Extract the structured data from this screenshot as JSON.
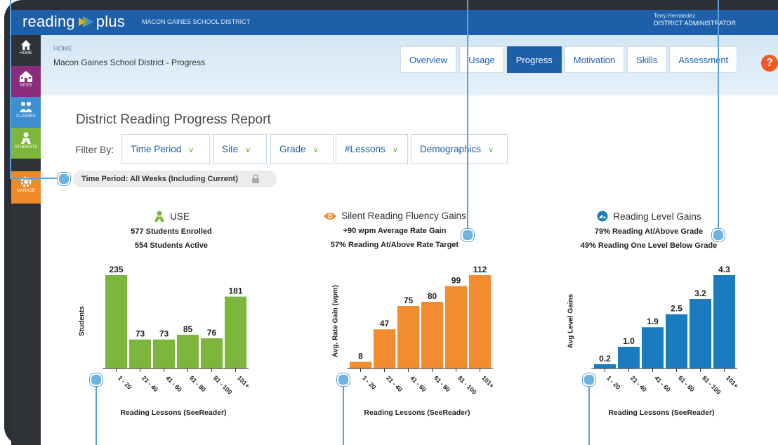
{
  "app": {
    "logo_text": "reading",
    "logo_text2": "plus",
    "district": "MACON GAINES SCHOOL DISTRICT",
    "user_name": "Terry Hernandez",
    "user_role": "DISTRICT ADMINISTRATOR"
  },
  "nav": [
    {
      "label": "HOME",
      "icon": "home-icon",
      "color": "#2f3237"
    },
    {
      "label": "SITES",
      "icon": "school-icon",
      "color": "#8b2b7c"
    },
    {
      "label": "CLASSES",
      "icon": "group-icon",
      "color": "#3d8fd0"
    },
    {
      "label": "STUDENTS",
      "icon": "student-icon",
      "color": "#7db63d"
    },
    {
      "label": "MANAGE",
      "icon": "gear-icon",
      "color": "#ef8a2b"
    }
  ],
  "header": {
    "breadcrumb": "HOME",
    "title": "Macon Gaines School District - Progress",
    "tabs": [
      "Overview",
      "Usage",
      "Progress",
      "Motivation",
      "Skills",
      "Assessment"
    ],
    "active_tab": "Progress",
    "help": "?"
  },
  "report": {
    "title": "District Reading Progress Report",
    "filter_label": "Filter By:",
    "filters": [
      "Time Period",
      "Site",
      "Grade",
      "#Lessons",
      "Demographics"
    ],
    "time_pill": "Time Period: All Weeks (Including Current)"
  },
  "sections": [
    {
      "head": "USE",
      "icon": "student-icon",
      "stat1": "577 Students Enrolled",
      "stat2": "554 Students Active",
      "ylabel": "Students",
      "xlabel": "Reading Lessons (SeeReader)"
    },
    {
      "head": "Silent Reading Fluency Gains",
      "icon": "eye-icon",
      "stat1": "+90 wpm Average Rate Gain",
      "stat2": "57% Reading At/Above Rate Target",
      "ylabel": "Avg. Rate Gain (wpm)",
      "xlabel": "Reading Lessons (SeeReader)"
    },
    {
      "head": "Reading Level Gains",
      "icon": "gauge-icon",
      "stat1": "79% Reading At/Above Grade",
      "stat2": "49% Reading One Level Below Grade",
      "ylabel": "Avg Level Gains",
      "xlabel": "Reading Lessons (SeeReader)"
    }
  ],
  "chart_data": [
    {
      "type": "bar",
      "categories": [
        "1 - 20",
        "21 - 40",
        "41 - 60",
        "61 - 80",
        "81 - 100",
        "101+"
      ],
      "values": [
        235,
        73,
        73,
        85,
        76,
        181
      ],
      "labels": [
        "235",
        "73",
        "73",
        "85",
        "76",
        "181"
      ],
      "color": "#7db63d",
      "ylabel": "Students",
      "xlabel": "Reading Lessons (SeeReader)",
      "ylim": [
        0,
        235
      ]
    },
    {
      "type": "bar",
      "categories": [
        "1 - 20",
        "21 - 40",
        "41 - 60",
        "61 - 80",
        "81 - 100",
        "101+"
      ],
      "values": [
        8,
        47,
        75,
        80,
        99,
        112
      ],
      "labels": [
        "8",
        "47",
        "75",
        "80",
        "99",
        "112"
      ],
      "color": "#f28c2f",
      "ylabel": "Avg. Rate Gain (wpm)",
      "xlabel": "Reading Lessons (SeeReader)",
      "ylim": [
        0,
        112
      ]
    },
    {
      "type": "bar",
      "categories": [
        "1 - 20",
        "21 - 40",
        "41 - 60",
        "61 - 80",
        "81 - 100",
        "101+"
      ],
      "values": [
        0.2,
        1.0,
        1.9,
        2.5,
        3.2,
        4.3
      ],
      "labels": [
        "0.2",
        "1.0",
        "1.9",
        "2.5",
        "3.2",
        "4.3"
      ],
      "color": "#1a7bbf",
      "ylabel": "Avg Level Gains",
      "xlabel": "Reading Lessons (SeeReader)",
      "ylim": [
        0,
        4.3
      ]
    }
  ]
}
